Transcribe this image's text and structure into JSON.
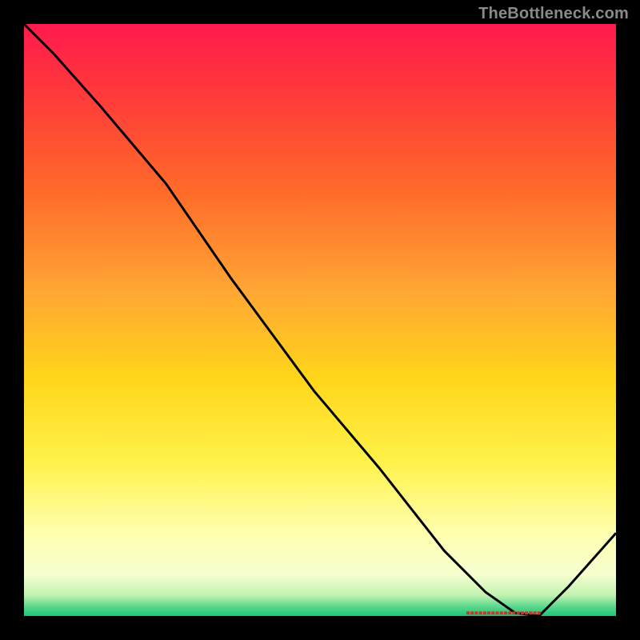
{
  "watermark": "TheBottleneck.com",
  "colors": {
    "frame": "#000000",
    "line": "#000000",
    "marker_fill": "#c8372b",
    "watermark_text": "#8a8a8a",
    "gradient_stops": [
      {
        "offset": 0.0,
        "color": "#ff1a4d"
      },
      {
        "offset": 0.12,
        "color": "#ff3a3a"
      },
      {
        "offset": 0.28,
        "color": "#ff6a2a"
      },
      {
        "offset": 0.45,
        "color": "#ffa634"
      },
      {
        "offset": 0.6,
        "color": "#ffd61a"
      },
      {
        "offset": 0.74,
        "color": "#fff24a"
      },
      {
        "offset": 0.86,
        "color": "#ffffb0"
      },
      {
        "offset": 0.93,
        "color": "#f7ffd0"
      },
      {
        "offset": 0.965,
        "color": "#c0f3b0"
      },
      {
        "offset": 0.985,
        "color": "#56d68a"
      },
      {
        "offset": 1.0,
        "color": "#1fc47a"
      }
    ]
  },
  "chart_data": {
    "type": "line",
    "title": "",
    "xlabel": "",
    "ylabel": "",
    "xlim": [
      0,
      100
    ],
    "ylim": [
      0,
      100
    ],
    "x": [
      0,
      5,
      13,
      24,
      35,
      49,
      60,
      71,
      78,
      83,
      87,
      92,
      100
    ],
    "values": [
      100,
      95,
      86,
      73,
      57,
      38,
      25,
      11,
      4,
      0.5,
      0,
      5,
      14
    ],
    "marker": {
      "x_start": 75,
      "x_end": 87,
      "y": 0.5,
      "color": "#c8372b"
    }
  }
}
